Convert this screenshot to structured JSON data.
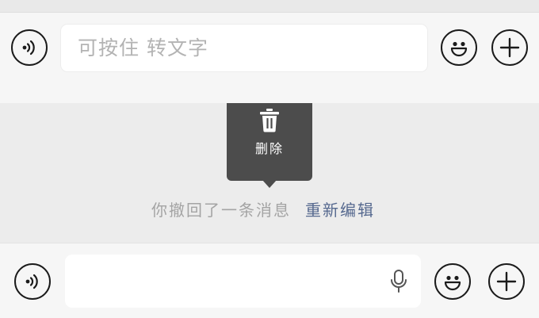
{
  "composer_top": {
    "placeholder": "可按住 转文字",
    "voice_icon": "voice-wave-icon",
    "emoji_icon": "smiley-face-icon",
    "plus_icon": "plus-circle-icon"
  },
  "context_menu": {
    "delete_icon": "trash-icon",
    "delete_label": "删除"
  },
  "system_message": {
    "text": "你撤回了一条消息",
    "action_label": "重新编辑",
    "action_color": "#56698f"
  },
  "composer_bottom": {
    "input_value": "",
    "voice_icon": "voice-wave-icon",
    "mic_icon": "microphone-icon",
    "emoji_icon": "smiley-face-icon",
    "plus_icon": "plus-circle-icon"
  }
}
